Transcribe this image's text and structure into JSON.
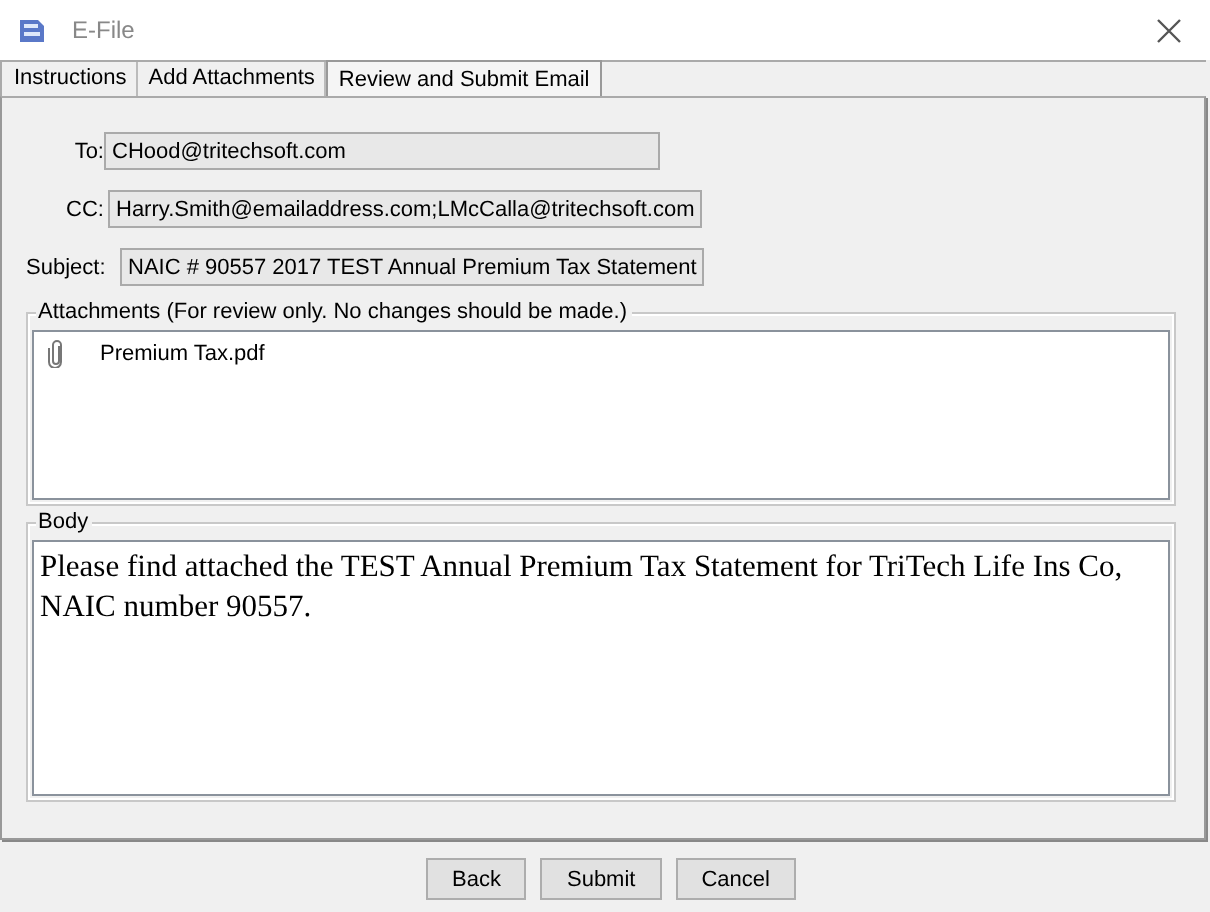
{
  "window": {
    "title": "E-File"
  },
  "tabs": [
    {
      "label": "Instructions",
      "selected": false
    },
    {
      "label": "Add Attachments",
      "selected": false
    },
    {
      "label": "Review and Submit Email",
      "selected": true
    }
  ],
  "fields": [
    {
      "label": "To:",
      "value": "CHood@tritechsoft.com"
    },
    {
      "label": "CC:",
      "value": "Harry.Smith@emailaddress.com;LMcCalla@tritechsoft.com"
    },
    {
      "label": "Subject:",
      "value": "NAIC # 90557 2017 TEST Annual Premium Tax Statement"
    }
  ],
  "attachments": {
    "title": "Attachments (For review only. No changes should be made.)",
    "items": [
      "Premium Tax.pdf"
    ]
  },
  "body": {
    "title": "Body",
    "lines": [
      "Please find attached the TEST Annual Premium Tax Statement for TriTech Life Ins Co,",
      "NAIC number 90557."
    ]
  },
  "buttons": [
    "Back",
    "Submit",
    "Cancel"
  ]
}
